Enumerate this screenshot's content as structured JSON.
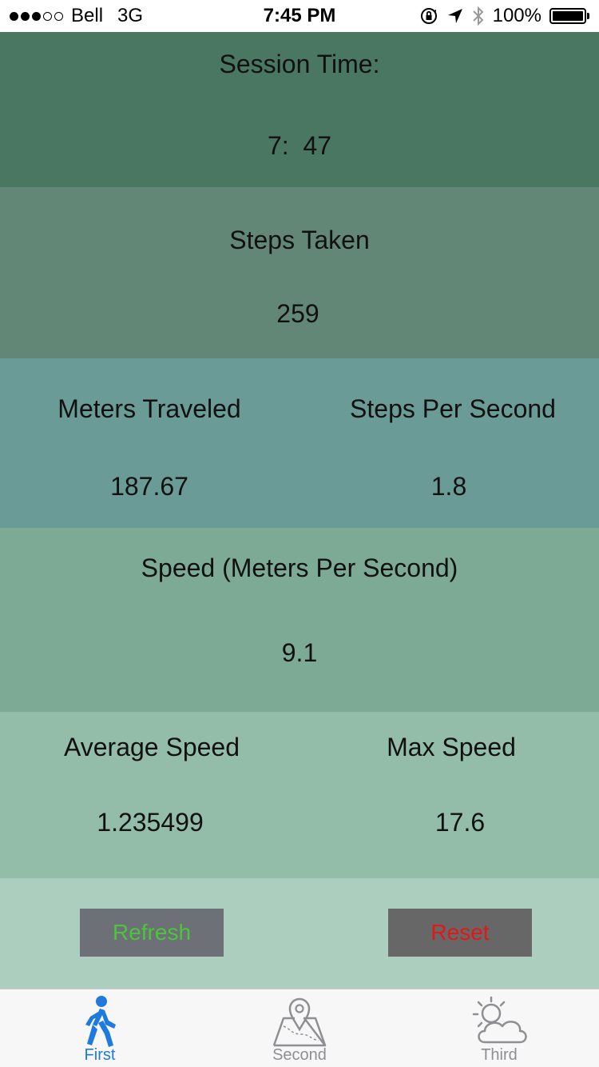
{
  "status_bar": {
    "carrier": "Bell",
    "network": "3G",
    "time": "7:45 PM",
    "battery_percent": "100%",
    "signal_bars_filled": 3,
    "signal_bars_total": 5,
    "icons": [
      "orientation-lock-icon",
      "location-arrow-icon",
      "bluetooth-icon",
      "battery-icon"
    ]
  },
  "session": {
    "label": "Session Time:",
    "value": "7:  47"
  },
  "steps": {
    "label": "Steps Taken",
    "value": "259"
  },
  "meters": {
    "label": "Meters Traveled",
    "value": "187.67"
  },
  "steps_per_second": {
    "label": "Steps Per Second",
    "value": "1.8"
  },
  "speed": {
    "label": "Speed (Meters Per Second)",
    "value": "9.1"
  },
  "average_speed": {
    "label": "Average Speed",
    "value": "1.235499"
  },
  "max_speed": {
    "label": "Max Speed",
    "value": "17.6"
  },
  "buttons": {
    "refresh_label": "Refresh",
    "reset_label": "Reset",
    "refresh_text_color": "#4ec43c",
    "reset_text_color": "#e01818"
  },
  "tabs": [
    {
      "label": "First",
      "icon": "walking-person-icon",
      "active": true
    },
    {
      "label": "Second",
      "icon": "map-pin-icon",
      "active": false
    },
    {
      "label": "Third",
      "icon": "sun-cloud-icon",
      "active": false
    }
  ],
  "colors": {
    "active_tab": "#1f7ae0",
    "inactive_tab": "#8e8e93"
  }
}
